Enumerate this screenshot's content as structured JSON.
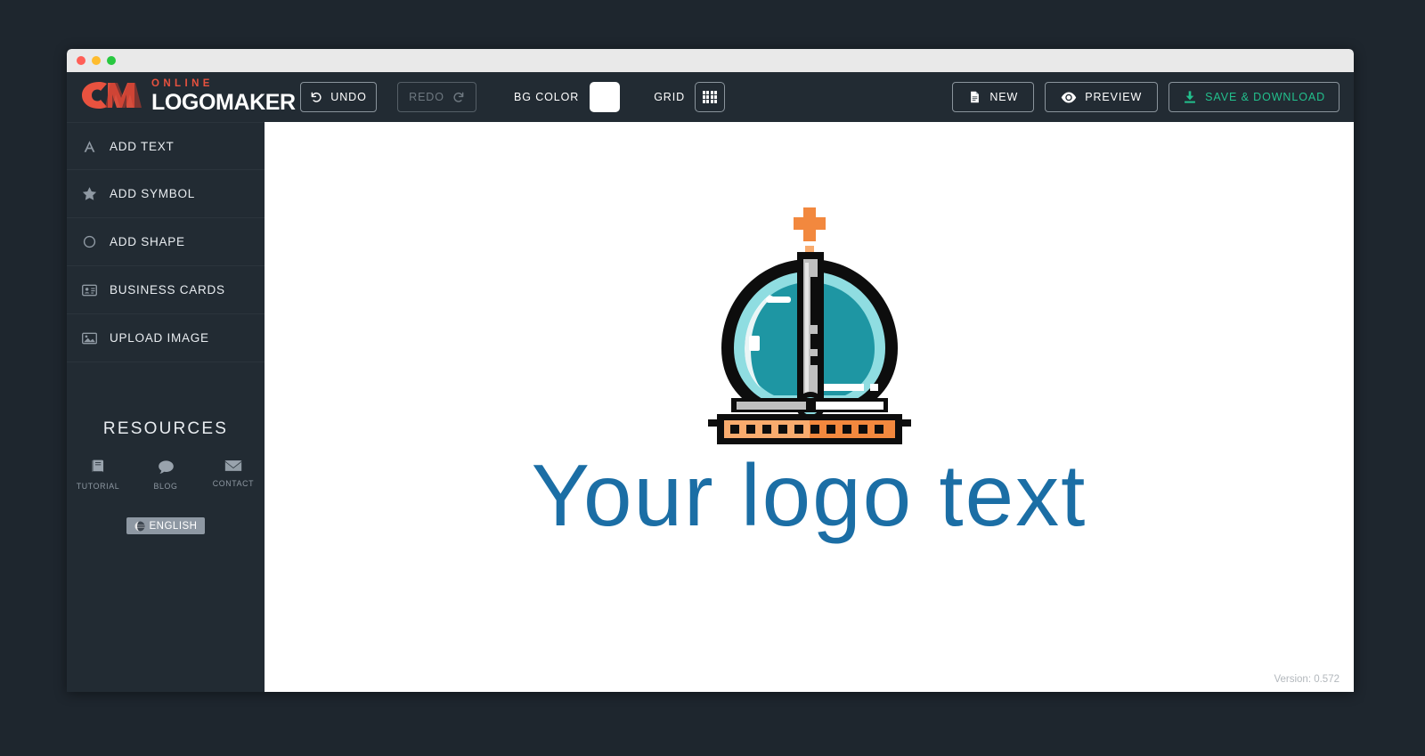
{
  "window": {
    "traffic_lights": [
      "close",
      "minimize",
      "maximize"
    ],
    "colors": {
      "close": "#ff5f57",
      "minimize": "#febc2e",
      "maximize": "#28c840",
      "titlebar_bg": "#e9e9e9",
      "app_bg": "#222b33",
      "page_bg": "#1e262e",
      "canvas_bg": "#ffffff"
    }
  },
  "brand": {
    "online": "ONLINE",
    "logo": "LOGO",
    "maker": "MAKER",
    "mark_icon": "cm-monogram-icon",
    "accent": "#e8523f"
  },
  "toolbar": {
    "undo_label": "UNDO",
    "undo_icon": "undo-arrow-icon",
    "redo_label": "REDO",
    "redo_icon": "redo-arrow-icon",
    "redo_disabled": true,
    "bg_color_label": "BG COLOR",
    "bg_color_value": "#ffffff",
    "grid_label": "GRID",
    "grid_icon": "grid-icon",
    "new_label": "NEW",
    "new_icon": "document-icon",
    "preview_label": "PREVIEW",
    "preview_icon": "eye-icon",
    "save_label": "SAVE & DOWNLOAD",
    "save_icon": "download-icon",
    "save_color": "#22c08d"
  },
  "sidebar": {
    "items": [
      {
        "label": "ADD TEXT",
        "icon": "text-a-icon"
      },
      {
        "label": "ADD SYMBOL",
        "icon": "star-icon"
      },
      {
        "label": "ADD SHAPE",
        "icon": "circle-icon"
      },
      {
        "label": "BUSINESS CARDS",
        "icon": "id-card-icon"
      },
      {
        "label": "UPLOAD IMAGE",
        "icon": "image-icon"
      }
    ],
    "resources": {
      "title": "RESOURCES",
      "links": [
        {
          "label": "TUTORIAL",
          "icon": "book-icon"
        },
        {
          "label": "BLOG",
          "icon": "speech-bubble-icon"
        },
        {
          "label": "CONTACT",
          "icon": "envelope-icon"
        }
      ]
    },
    "language": {
      "label": "ENGLISH",
      "icon": "globe-icon"
    }
  },
  "canvas": {
    "logo_text": "Your logo text",
    "logo_text_color": "#1b6ea5",
    "mark": {
      "name": "hot-air-balloon-crown-mark",
      "colors": {
        "outline": "#0d0d0d",
        "teal": "#1e96a3",
        "teal_light": "#8fdde1",
        "orange": "#f2883e",
        "orange_light": "#f8ab6e",
        "grey": "#bfbfbf",
        "white": "#ffffff"
      }
    },
    "version": "Version: 0.572"
  }
}
